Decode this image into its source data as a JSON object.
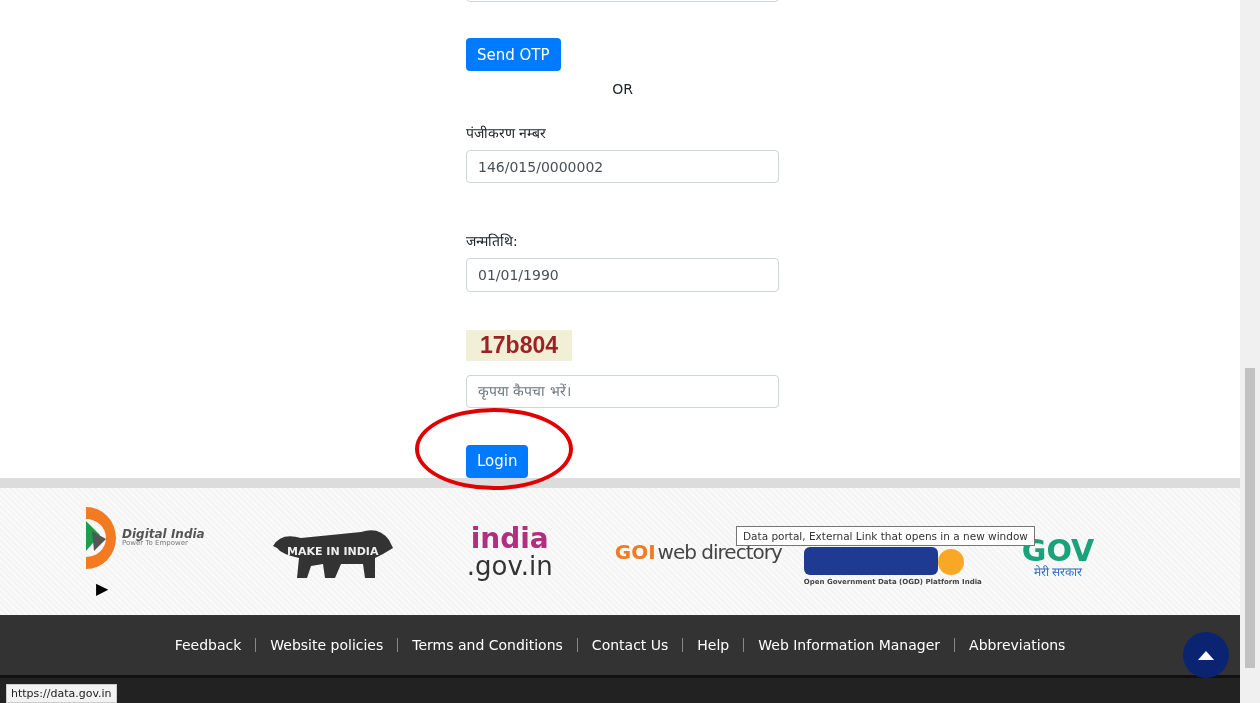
{
  "form": {
    "send_otp_button": "Send OTP",
    "or_text": "OR",
    "fields": [
      {
        "label": "पंजीकरण नम्बर",
        "value": "146/015/0000002"
      },
      {
        "label": "जन्मतिथि:",
        "value": "01/01/1990"
      }
    ],
    "captcha": "17b804",
    "captcha_field": {
      "placeholder": "कृपया कैपचा भरें।"
    },
    "login_button": "Login",
    "highlight_login": true
  },
  "logos": {
    "digital_india": {
      "title": "Digital India",
      "tagline": "Power To Empower"
    },
    "make_in_india": "MAKE IN INDIA",
    "india_gov": {
      "line_1": "india",
      "line_2": ".gov.in"
    },
    "goi": {
      "mark": "GOI",
      "text": "web directory"
    },
    "data_gov": {
      "subtitle": "Open Government Data (OGD) Platform India"
    },
    "mygov": {
      "mark": "GOV",
      "subtitle": "मेरी सरकार"
    },
    "play_symbol": "▶"
  },
  "tooltip": "Data portal, External Link that opens in a new window",
  "footer_links": [
    "Feedback",
    "Website policies",
    "Terms and Conditions",
    "Contact Us",
    "Help",
    "Web Information Manager",
    "Abbreviations"
  ],
  "status_url": "https://data.gov.in"
}
